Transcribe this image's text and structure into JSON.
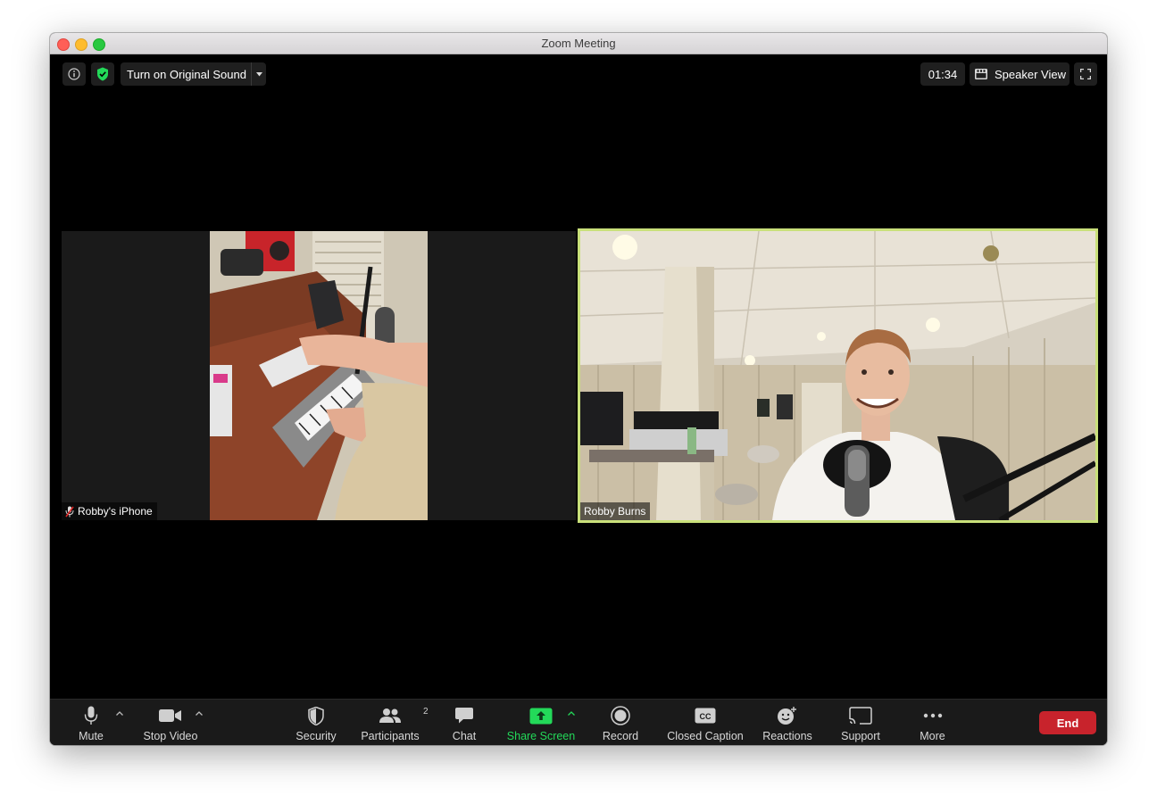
{
  "window": {
    "title": "Zoom Meeting"
  },
  "top_bar": {
    "original_sound_label": "Turn on Original Sound",
    "timer": "01:34",
    "view_label": "Speaker View"
  },
  "participants": [
    {
      "name": "Robby's iPhone",
      "muted": true
    },
    {
      "name": "Robby Burns",
      "muted": false,
      "active_speaker": true
    }
  ],
  "toolbar": {
    "mute_label": "Mute",
    "stop_video_label": "Stop Video",
    "security_label": "Security",
    "participants_label": "Participants",
    "participants_count": "2",
    "chat_label": "Chat",
    "share_screen_label": "Share Screen",
    "record_label": "Record",
    "closed_caption_label": "Closed Caption",
    "reactions_label": "Reactions",
    "support_label": "Support",
    "more_label": "More",
    "end_label": "End"
  },
  "colors": {
    "active_speaker_border": "#c9e07a",
    "share_green": "#23d959",
    "end_red": "#c8232c",
    "shield_green": "#23d959"
  }
}
